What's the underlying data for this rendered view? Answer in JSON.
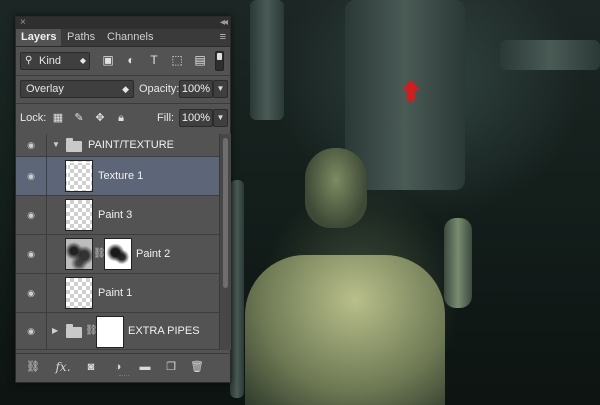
{
  "panel": {
    "tabs": [
      {
        "label": "Layers"
      },
      {
        "label": "Paths"
      },
      {
        "label": "Channels"
      }
    ],
    "kind_label": "Kind",
    "blend_mode": "Overlay",
    "opacity_label": "Opacity:",
    "opacity_value": "100%",
    "lock_label": "Lock:",
    "fill_label": "Fill:",
    "fill_value": "100%"
  },
  "layers": [
    {
      "name": "PAINT/TEXTURE",
      "type": "group-open"
    },
    {
      "name": "Texture 1",
      "type": "layer",
      "selected": true
    },
    {
      "name": "Paint 3",
      "type": "layer"
    },
    {
      "name": "Paint 2",
      "type": "layer-mask"
    },
    {
      "name": "Paint 1",
      "type": "layer"
    },
    {
      "name": "EXTRA PIPES",
      "type": "group-closed"
    }
  ],
  "colors": {
    "panel_bg": "#535353",
    "selected_row": "#5d6679",
    "arrow_red": "#d31c1c"
  }
}
